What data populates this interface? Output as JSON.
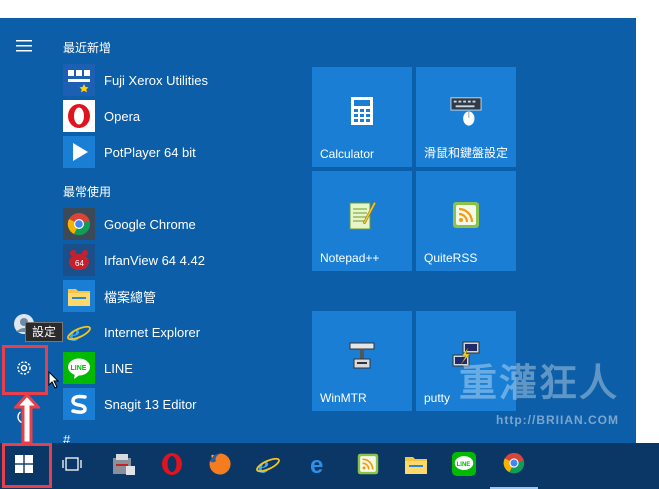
{
  "sections": {
    "recent_header": "最近新增",
    "most_used_header": "最常使用",
    "hash_header": "#"
  },
  "recent_apps": [
    {
      "label": "Fuji Xerox Utilities",
      "icon": "fuji-xerox-icon"
    },
    {
      "label": "Opera",
      "icon": "opera-icon"
    },
    {
      "label": "PotPlayer 64 bit",
      "icon": "potplayer-icon"
    }
  ],
  "most_used_apps": [
    {
      "label": "Google Chrome",
      "icon": "chrome-icon"
    },
    {
      "label": "IrfanView 64 4.42",
      "icon": "irfanview-icon"
    },
    {
      "label": "檔案總管",
      "icon": "file-explorer-icon"
    },
    {
      "label": "Internet Explorer",
      "icon": "internet-explorer-icon"
    },
    {
      "label": "LINE",
      "icon": "line-icon"
    },
    {
      "label": "Snagit 13 Editor",
      "icon": "snagit-icon"
    }
  ],
  "tiles": [
    {
      "label": "Calculator",
      "icon": "calculator-icon"
    },
    {
      "label": "滑鼠和鍵盤設定",
      "icon": "mouse-keyboard-icon"
    },
    {
      "label": "Notepad++",
      "icon": "notepad-plus-plus-icon"
    },
    {
      "label": "QuiteRSS",
      "icon": "quiterss-icon"
    },
    {
      "label": "WinMTR",
      "icon": "winmtr-icon"
    },
    {
      "label": "putty",
      "icon": "putty-icon"
    }
  ],
  "tooltip": "設定",
  "watermark": {
    "text": "重灌狂人",
    "url": "http://BRIIAN.COM"
  },
  "colors": {
    "start_menu_bg": "#0b5ea7",
    "tile_bg": "#1a7fd4",
    "taskbar_bg": "#0a3765",
    "highlight": "#e8404a"
  }
}
